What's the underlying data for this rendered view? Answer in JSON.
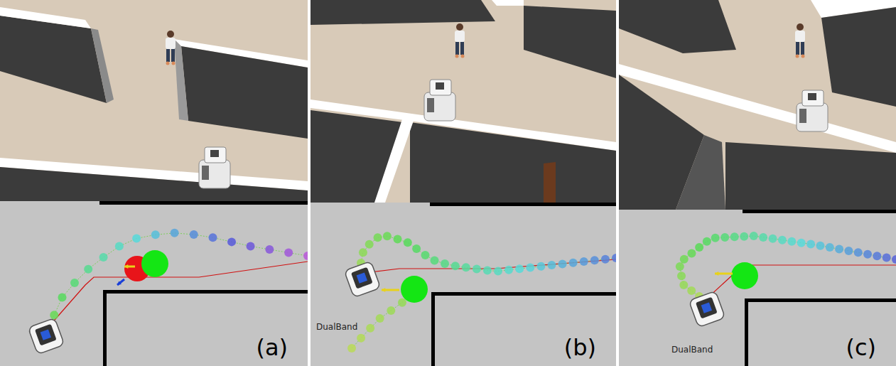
{
  "figure": {
    "panels": [
      {
        "label": "(a)"
      },
      {
        "label": "(b)",
        "map_text": "DualBand"
      },
      {
        "label": "(c)",
        "map_text": "DualBand"
      }
    ]
  }
}
